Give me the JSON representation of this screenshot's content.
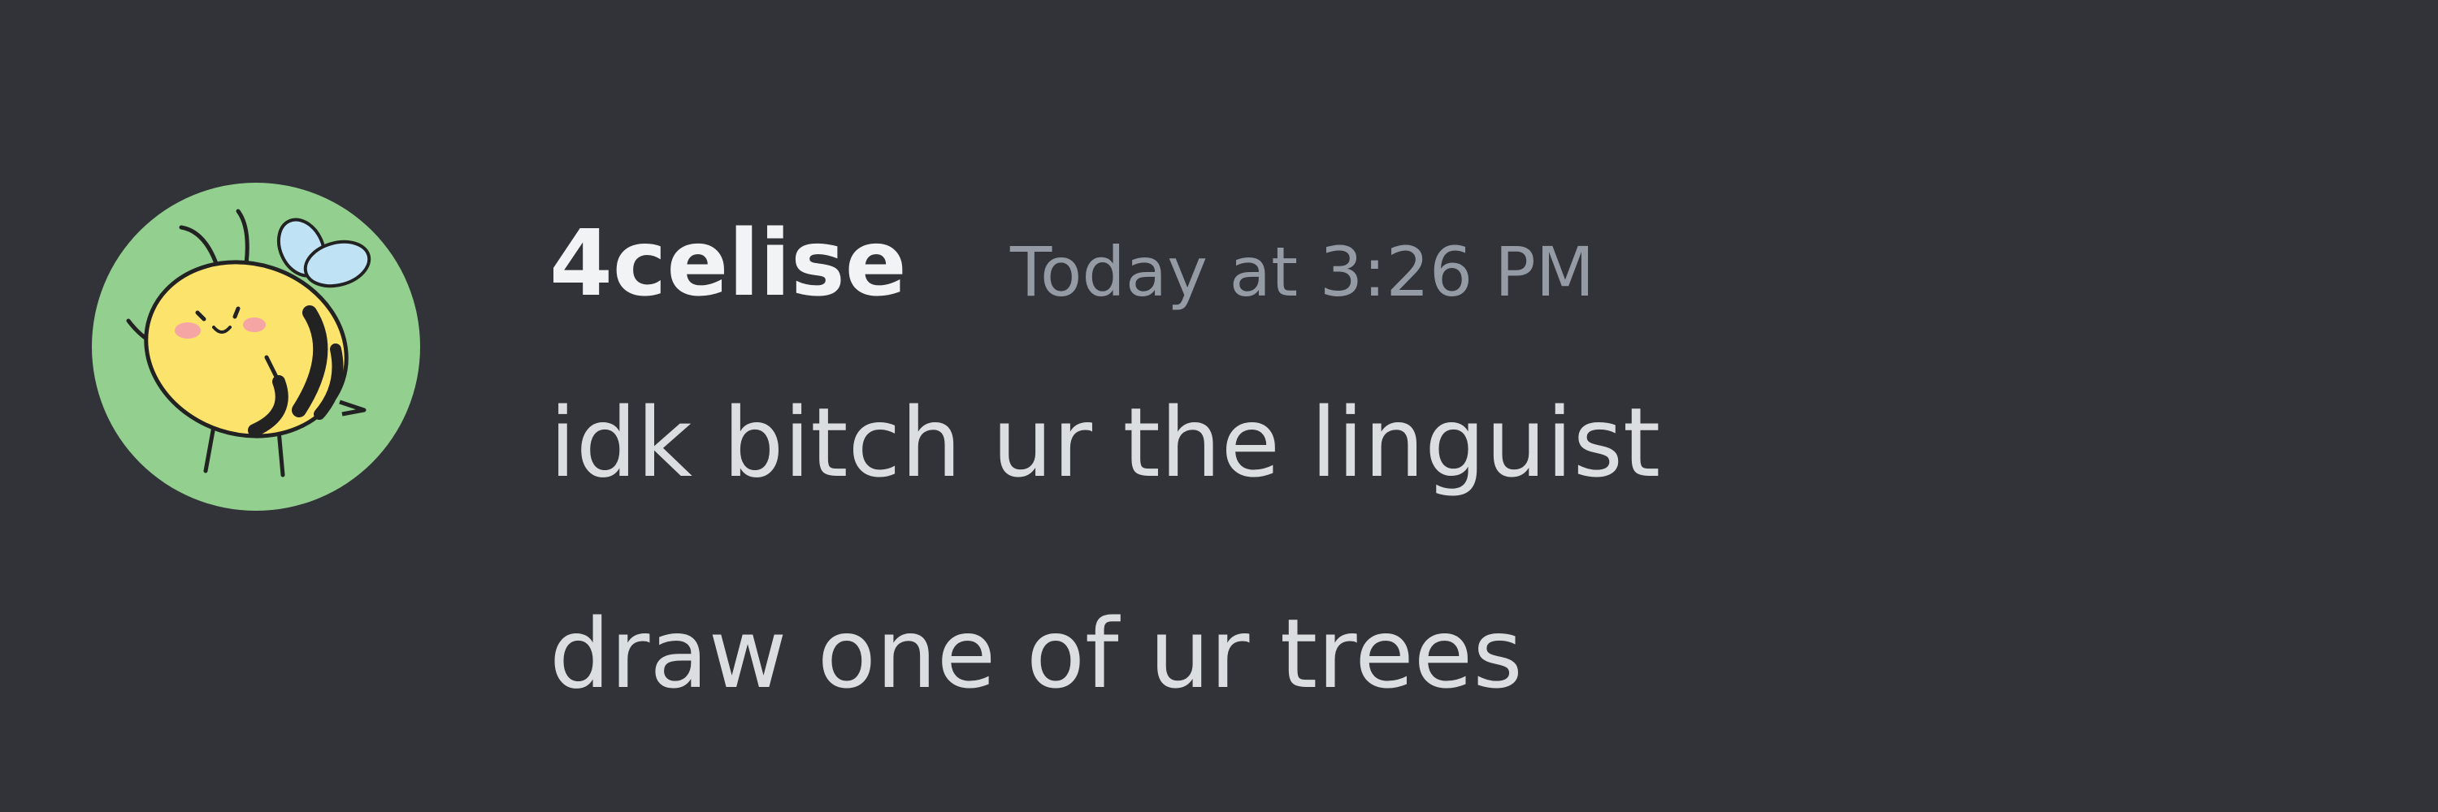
{
  "message": {
    "avatar_icon": "bee-icon",
    "author": "4celise",
    "timestamp": "Today at 3:26 PM",
    "lines": [
      "idk bitch ur the linguist",
      "draw one of ur trees"
    ]
  },
  "colors": {
    "background": "#313338",
    "avatar_background": "#93cf8e",
    "username": "#f2f3f5",
    "timestamp": "#949ba4",
    "message_text": "#dbdee1"
  }
}
